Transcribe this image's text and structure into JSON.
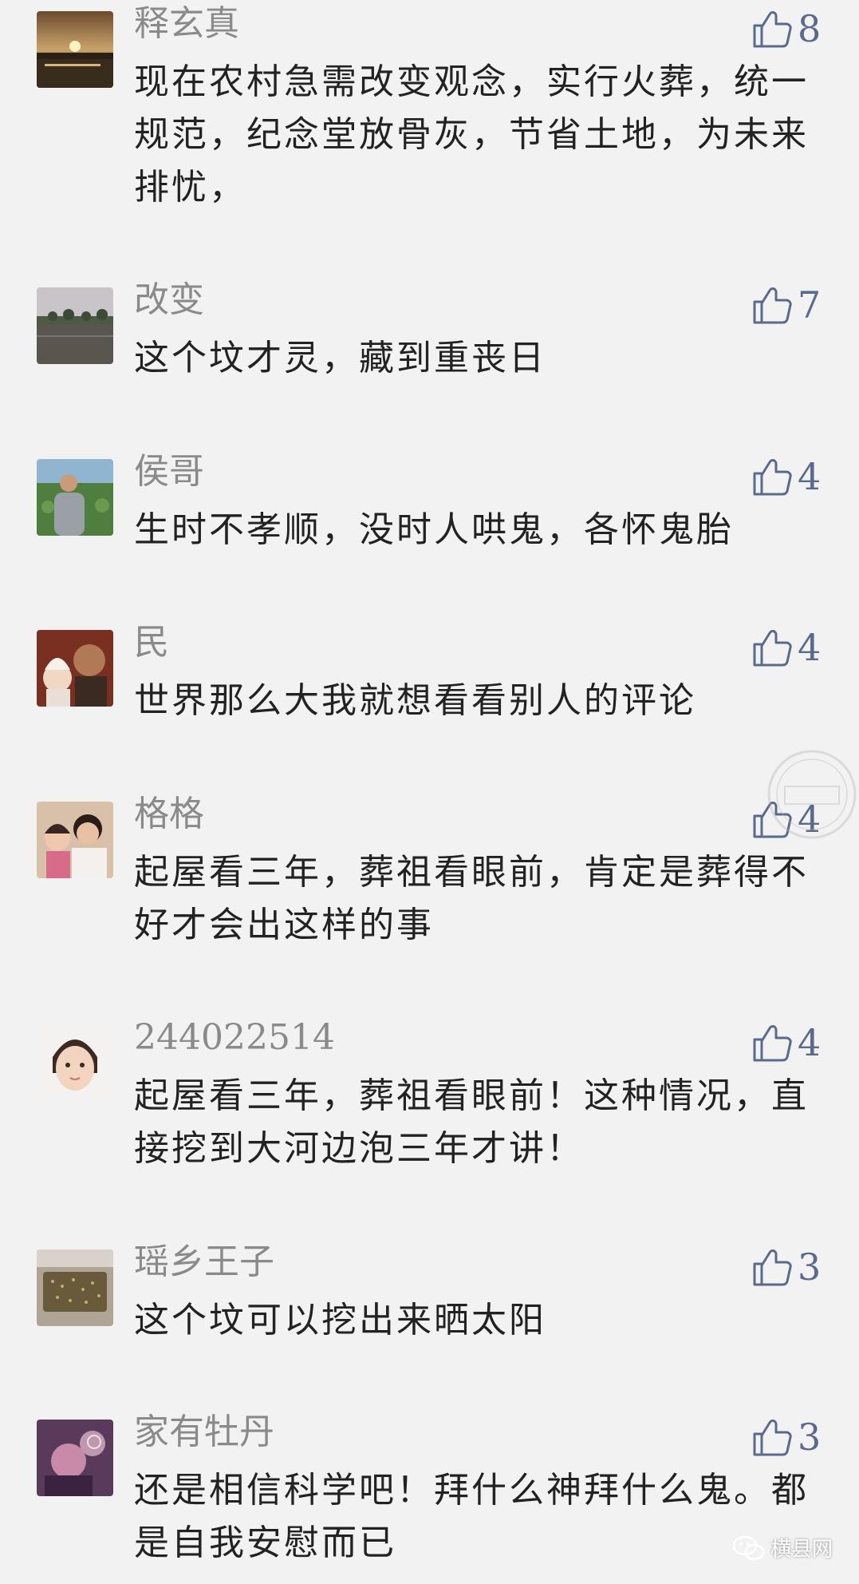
{
  "colors": {
    "background": "#f2f2f2",
    "username": "#8a8a8a",
    "comment_text": "#222222",
    "like_accent": "#5a6a8c"
  },
  "comments": [
    {
      "username": "释玄真",
      "likes": "8",
      "avatar": "sunset-avatar",
      "text": "现在农村急需改变观念，实行火葬，统一规范，纪念堂放骨灰，节省土地，为未来排忧，"
    },
    {
      "username": "改变",
      "likes": "7",
      "avatar": "lake-avatar",
      "text": "这个坟才灵，藏到重丧日"
    },
    {
      "username": "侯哥",
      "likes": "4",
      "avatar": "man-lotus-avatar",
      "text": "生时不孝顺，没时人哄鬼，各怀鬼胎"
    },
    {
      "username": "民",
      "likes": "4",
      "avatar": "father-baby-avatar",
      "text": "世界那么大我就想看看别人的评论"
    },
    {
      "username": "格格",
      "likes": "4",
      "avatar": "mother-child-avatar",
      "text": "起屋看三年，葬祖看眼前，肯定是葬得不好才会出这样的事"
    },
    {
      "username": "244022514",
      "likes": "4",
      "avatar": "girl-avatar",
      "text": "起屋看三年，葬祖看眼前！这种情况，直接挖到大河边泡三年才讲！"
    },
    {
      "username": "瑶乡王子",
      "likes": "3",
      "avatar": "seeds-avatar",
      "text": "这个坟可以挖出来晒太阳"
    },
    {
      "username": "家有牡丹",
      "likes": "3",
      "avatar": "child-pink-avatar",
      "text": "还是相信科学吧！拜什么神拜什么鬼。都是自我安慰而已"
    }
  ],
  "footer": {
    "brand": "横县网",
    "icon": "wechat-icon"
  },
  "watermark": {
    "icon": "seal-watermark-icon"
  }
}
